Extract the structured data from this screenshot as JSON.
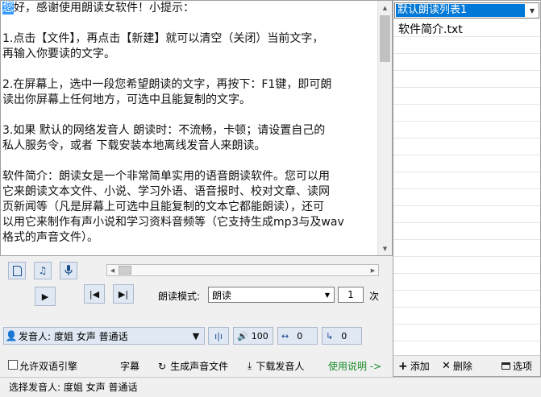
{
  "editor": {
    "lines": [
      {
        "pre": "您",
        "text": "好，感谢使用朗读女软件！小提示："
      },
      {
        "gap": true
      },
      {
        "text": "1.点击【文件】，再点击【新建】就可以清空（关闭）当前文字，"
      },
      {
        "text": "再输入你要读的文字。"
      },
      {
        "gap": true
      },
      {
        "text": "2.在屏幕上，选中一段您希望朗读的文字，再按下：F1键，即可朗"
      },
      {
        "text": "读出你屏幕上任何地方，可选中且能复制的文字。"
      },
      {
        "gap": true
      },
      {
        "text": "3.如果 默认的网络发音人 朗读时：不流畅，卡顿；请设置自己的"
      },
      {
        "text": "私人服务令，或者 下载安装本地离线发音人来朗读。"
      },
      {
        "gap": true
      },
      {
        "text": "软件简介：朗读女是一个非常简单实用的语音朗读软件。您可以用"
      },
      {
        "text": "它来朗读文本文件、小说、学习外语、语音报时、校对文章、读网"
      },
      {
        "text": "页新闻等（凡是屏幕上可选中且能复制的文本它都能朗读），还可"
      },
      {
        "text": "以用它来制作有声小说和学习资料音频等（它支持生成mp3与及wav"
      },
      {
        "text": "格式的声音文件）。"
      }
    ]
  },
  "playlist": {
    "selected_list": "默认朗读列表1",
    "items": [
      "软件简介.txt"
    ],
    "add_label": "添加",
    "delete_label": "删除",
    "options_label": "选项"
  },
  "controls": {
    "mode_label": "朗读模式:",
    "mode_value": "朗读",
    "repeat_value": "1",
    "repeat_unit": "次",
    "voice_prefix": "发音人:",
    "voice_value": "度姐 女声 普通话",
    "volume": "100",
    "speed": "0",
    "pitch": "0",
    "bilingual_label": "允许双语引擎",
    "subtitle_label": "字幕",
    "generate_label": "生成声音文件",
    "download_label": "下载发音人",
    "help_label": "使用说明 ->"
  },
  "status": {
    "text": "选择发音人: 度姐 女声 普通话"
  },
  "colors": {
    "selection": "#3399ff",
    "button_bg": "#dfe8f3",
    "help_link": "#1a8c2a"
  }
}
